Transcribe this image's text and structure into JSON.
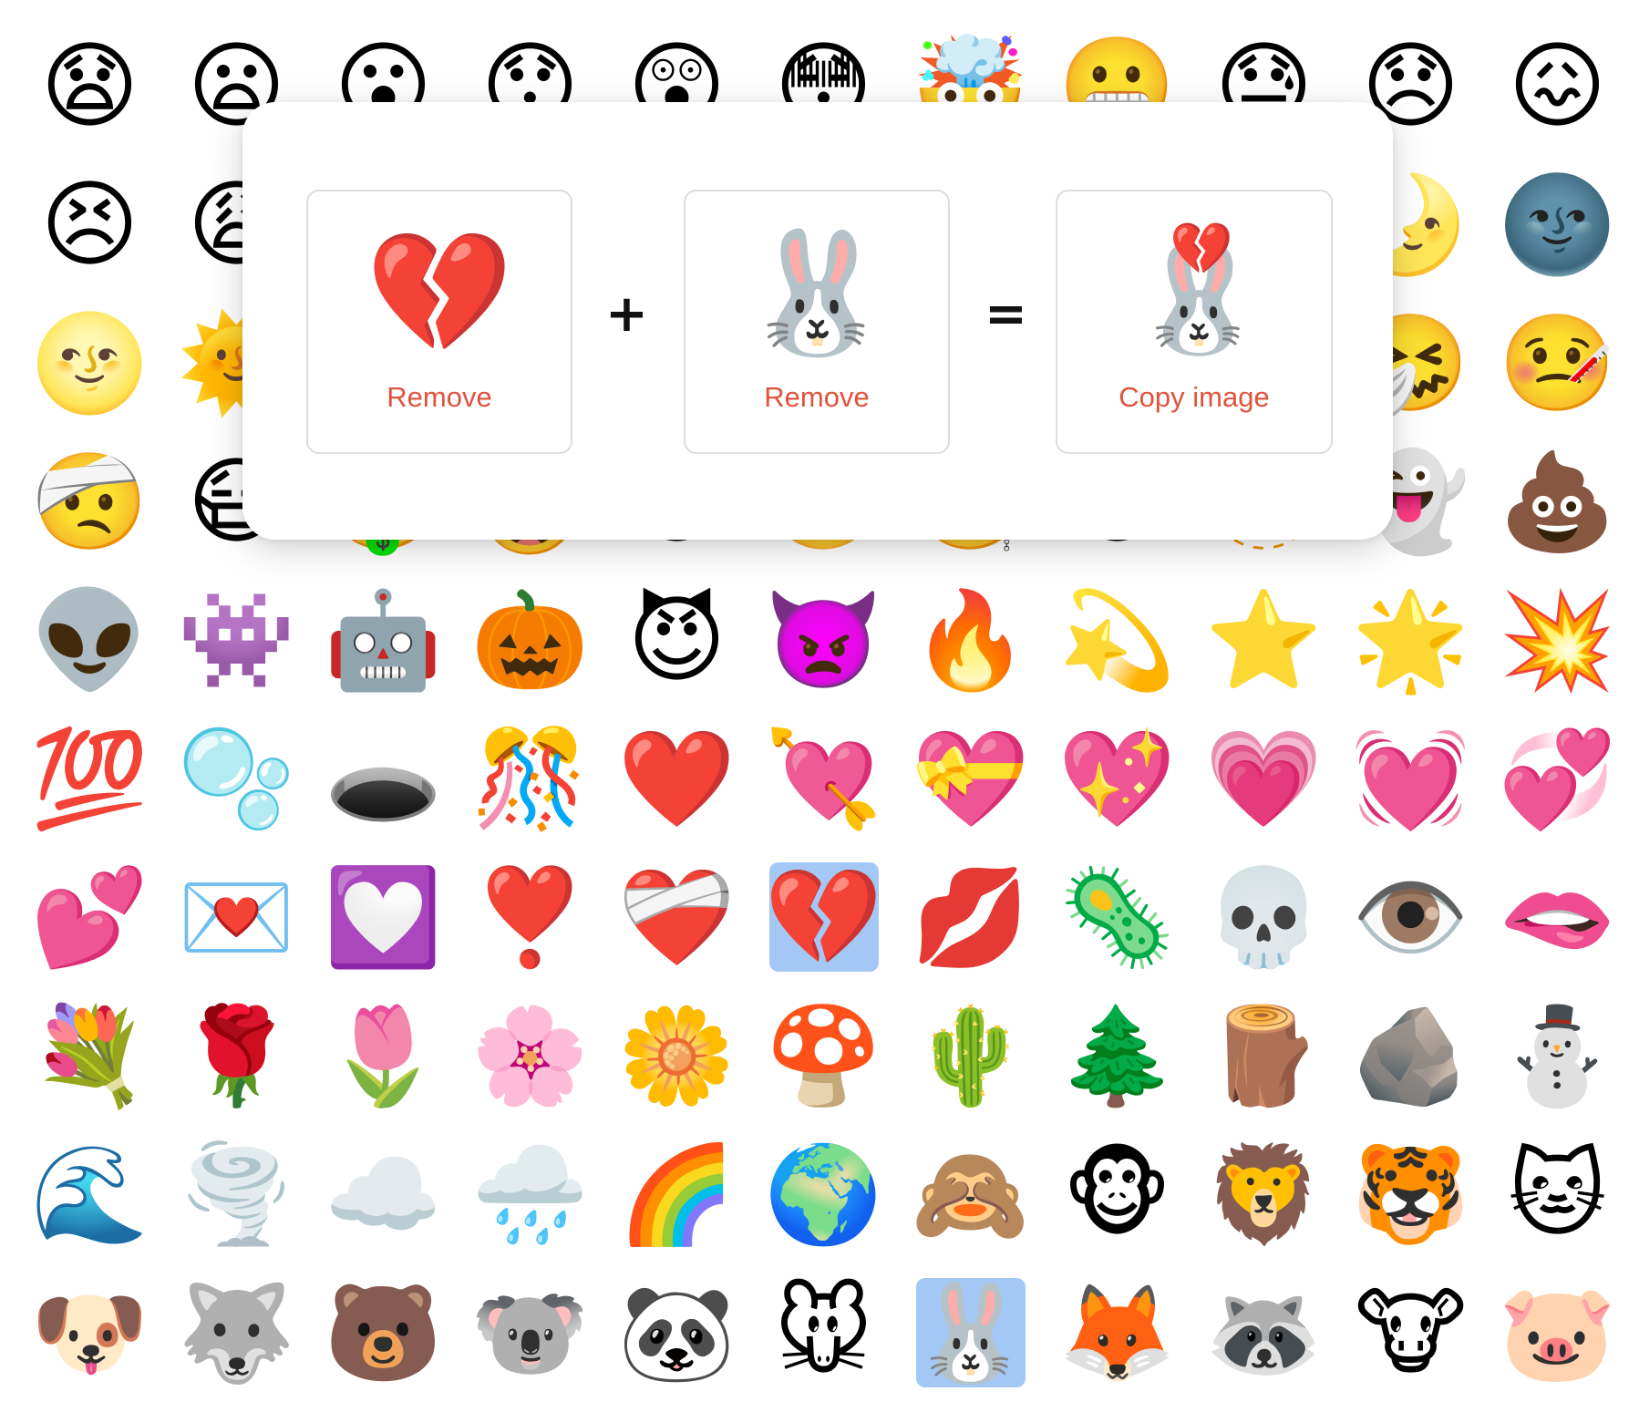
{
  "grid": {
    "rows": [
      [
        "😧",
        "😦",
        "😮",
        "😯",
        "😲",
        "😳",
        "🤯",
        "😬",
        "😓",
        "😞",
        "😖"
      ],
      [
        "😣",
        "😩",
        "😫",
        "🥱",
        "😤",
        "😡",
        "😠",
        "🤬",
        "😈",
        "🌛",
        "🌚"
      ],
      [
        "🌝",
        "🌞",
        "😴",
        "🤤",
        "😪",
        "😵",
        "🤐",
        "🥴",
        "🤢",
        "🤧",
        "🤒"
      ],
      [
        "🤕",
        "😷",
        "🤑",
        "🤠",
        "😎",
        "🤓",
        "🧐",
        "😕",
        "🫥",
        "👻",
        "💩"
      ],
      [
        "👽",
        "👾",
        "🤖",
        "🎃",
        "😈",
        "👿",
        "🔥",
        "💫",
        "⭐",
        "🌟",
        "💥"
      ],
      [
        "💯",
        "🫧",
        "🕳️",
        "🎊",
        "❤️",
        "💘",
        "💝",
        "💖",
        "💗",
        "💓",
        "💞"
      ],
      [
        "💕",
        "💌",
        "💟",
        "❣️",
        "❤️‍🩹",
        "💔",
        "💋",
        "🦠",
        "💀",
        "👁️",
        "🫦"
      ],
      [
        "💐",
        "🌹",
        "🌷",
        "🌸",
        "🌼",
        "🍄",
        "🌵",
        "🌲",
        "🪵",
        "🪨",
        "⛄"
      ],
      [
        "🌊",
        "🌪️",
        "☁️",
        "🌧️",
        "🌈",
        "🌍",
        "🙈",
        "🐵",
        "🦁",
        "🐯",
        "🐱"
      ],
      [
        "🐶",
        "🐺",
        "🐻",
        "🐨",
        "🐼",
        "🐭",
        "🐰",
        "🦊",
        "🦝",
        "🐮",
        "🐷"
      ]
    ]
  },
  "kitchen": {
    "first": {
      "emoji": "💔",
      "action_label": "Remove"
    },
    "plus": "+",
    "second": {
      "emoji": "🐰",
      "action_label": "Remove"
    },
    "equals": "=",
    "result": {
      "top_emoji": "💔",
      "base_emoji": "🐰",
      "action_label": "Copy image"
    }
  },
  "colors": {
    "action_text": "#e0533d",
    "selected_highlight": "#a3c8f5"
  }
}
